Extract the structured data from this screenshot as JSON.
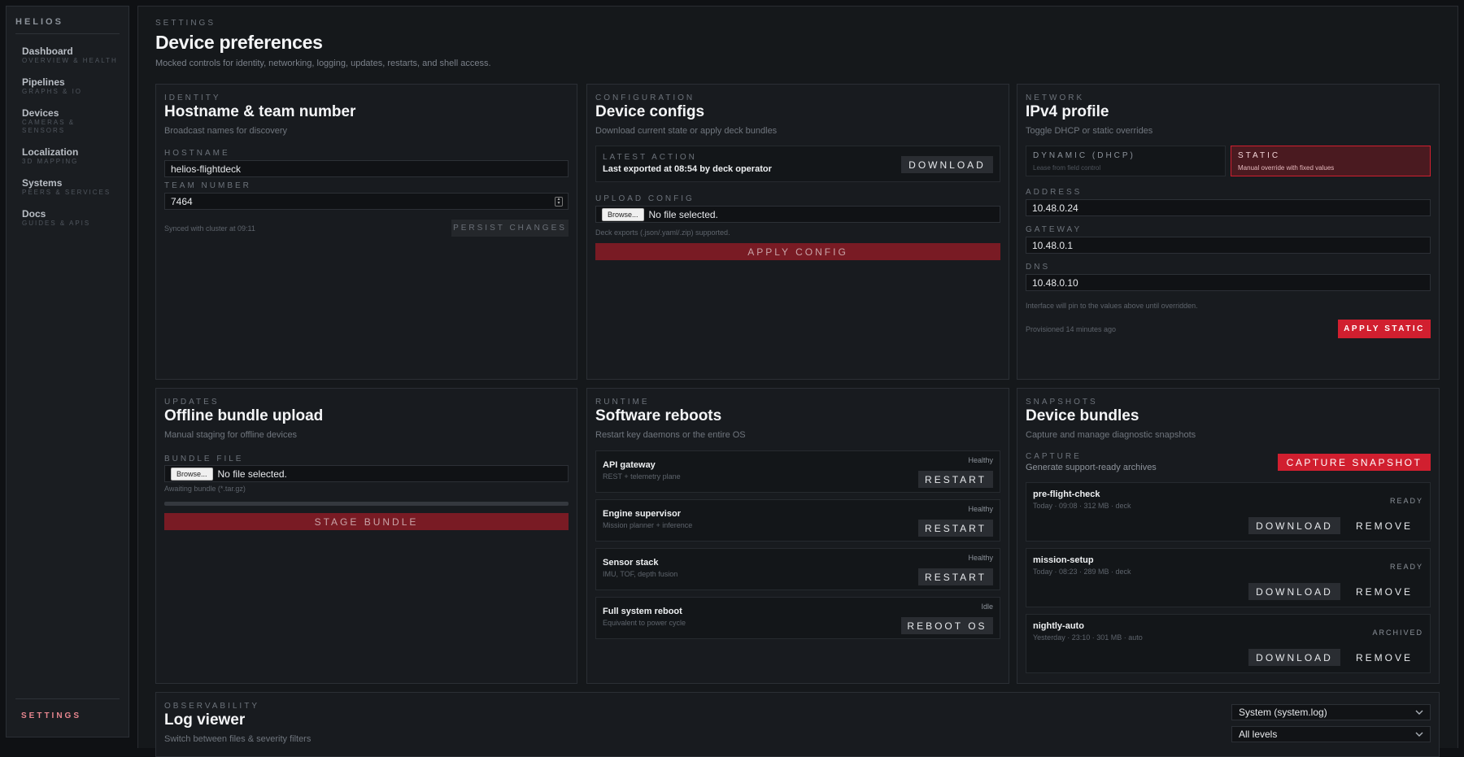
{
  "sidebar": {
    "brand": "HELIOS",
    "items": [
      {
        "title": "Dashboard",
        "subtitle": "OVERVIEW & HEALTH"
      },
      {
        "title": "Pipelines",
        "subtitle": "GRAPHS & IO"
      },
      {
        "title": "Devices",
        "subtitle": "CAMERAS & SENSORS"
      },
      {
        "title": "Localization",
        "subtitle": "3D MAPPING"
      },
      {
        "title": "Systems",
        "subtitle": "PEERS & SERVICES"
      },
      {
        "title": "Docs",
        "subtitle": "GUIDES & APIS"
      }
    ],
    "settings_label": "SETTINGS"
  },
  "header": {
    "eyebrow": "SETTINGS",
    "title": "Device preferences",
    "subtitle": "Mocked controls for identity, networking, logging, updates, restarts, and shell access."
  },
  "identity": {
    "eyebrow": "IDENTITY",
    "title": "Hostname & team number",
    "subtitle": "Broadcast names for discovery",
    "hostname_label": "HOSTNAME",
    "hostname_value": "helios-flightdeck",
    "team_label": "TEAM NUMBER",
    "team_value": "7464",
    "sync_text": "Synced with cluster at 09:11",
    "persist_label": "PERSIST CHANGES"
  },
  "configuration": {
    "eyebrow": "CONFIGURATION",
    "title": "Device configs",
    "subtitle": "Download current state or apply deck bundles",
    "latest_label": "LATEST ACTION",
    "latest_value": "Last exported at 08:54 by deck operator",
    "download_label": "DOWNLOAD",
    "upload_label": "UPLOAD CONFIG",
    "browse_label": "Browse...",
    "file_status": "No file selected.",
    "hint": "Deck exports (.json/.yaml/.zip) supported.",
    "apply_label": "APPLY CONFIG"
  },
  "network": {
    "eyebrow": "NETWORK",
    "title": "IPv4 profile",
    "subtitle": "Toggle DHCP or static overrides",
    "dhcp_title": "DYNAMIC (DHCP)",
    "dhcp_desc": "Lease from field control",
    "static_title": "STATIC",
    "static_desc": "Manual override with fixed values",
    "address_label": "ADDRESS",
    "address_value": "10.48.0.24",
    "gateway_label": "GATEWAY",
    "gateway_value": "10.48.0.1",
    "dns_label": "DNS",
    "dns_value": "10.48.0.10",
    "pin_note": "Interface will pin to the values above until overridden.",
    "provisioned": "Provisioned 14 minutes ago",
    "apply_label": "APPLY STATIC",
    "accent": "#d11f2f"
  },
  "updates": {
    "eyebrow": "UPDATES",
    "title": "Offline bundle upload",
    "subtitle": "Manual staging for offline devices",
    "file_label": "BUNDLE FILE",
    "browse_label": "Browse...",
    "file_status": "No file selected.",
    "hint": "Awaiting bundle (*.tar.gz)",
    "progress": 0,
    "stage_label": "STAGE BUNDLE"
  },
  "runtime": {
    "eyebrow": "RUNTIME",
    "title": "Software reboots",
    "subtitle": "Restart key daemons or the entire OS",
    "rows": [
      {
        "name": "API gateway",
        "desc": "REST + telemetry plane",
        "status": "Healthy",
        "action": "RESTART"
      },
      {
        "name": "Engine supervisor",
        "desc": "Mission planner + inference",
        "status": "Healthy",
        "action": "RESTART"
      },
      {
        "name": "Sensor stack",
        "desc": "IMU, TOF, depth fusion",
        "status": "Healthy",
        "action": "RESTART"
      },
      {
        "name": "Full system reboot",
        "desc": "Equivalent to power cycle",
        "status": "Idle",
        "action": "REBOOT OS"
      }
    ]
  },
  "snapshots": {
    "eyebrow": "SNAPSHOTS",
    "title": "Device bundles",
    "subtitle": "Capture and manage diagnostic snapshots",
    "capture_label": "CAPTURE",
    "capture_desc": "Generate support-ready archives",
    "capture_button": "CAPTURE SNAPSHOT",
    "items": [
      {
        "name": "pre-flight-check",
        "meta": "Today · 09:08 · 312 MB · deck",
        "status": "READY",
        "download": "DOWNLOAD",
        "remove": "REMOVE"
      },
      {
        "name": "mission-setup",
        "meta": "Today · 08:23 · 289 MB · deck",
        "status": "READY",
        "download": "DOWNLOAD",
        "remove": "REMOVE"
      },
      {
        "name": "nightly-auto",
        "meta": "Yesterday · 23:10 · 301 MB · auto",
        "status": "ARCHIVED",
        "download": "DOWNLOAD",
        "remove": "REMOVE"
      }
    ]
  },
  "observability": {
    "eyebrow": "OBSERVABILITY",
    "title": "Log viewer",
    "subtitle": "Switch between files & severity filters",
    "file_select": "System (system.log)",
    "level_select": "All levels"
  }
}
